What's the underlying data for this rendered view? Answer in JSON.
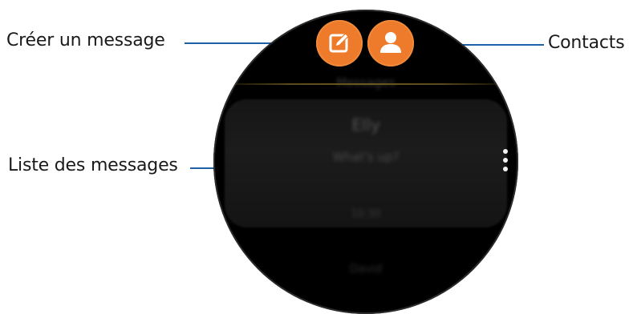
{
  "callouts": {
    "compose": "Créer un message",
    "message_list": "Liste des messages",
    "contacts": "Contacts"
  },
  "watch": {
    "header_title": "Messages",
    "messages": {
      "sender": "Elly",
      "preview": "What's up?",
      "time": "10:30",
      "faded_item": "David"
    }
  },
  "colors": {
    "accent": "#ee7a2b",
    "callout_line": "#1f5fa8",
    "watch_bg": "#000000"
  },
  "icons": {
    "compose": "compose-icon",
    "contacts": "contact-icon",
    "more": "more-options-icon"
  }
}
